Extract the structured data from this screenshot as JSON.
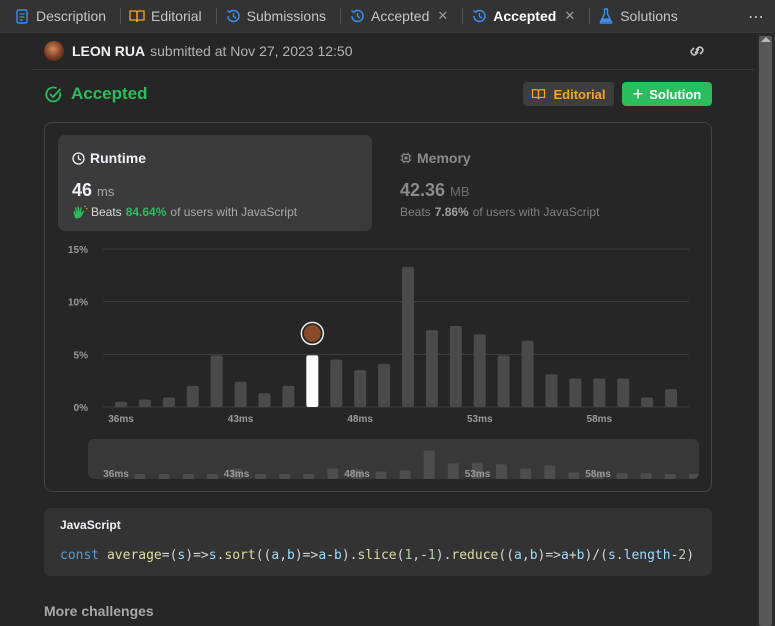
{
  "tabs": [
    {
      "label": "Description",
      "icon": "description-icon",
      "active": false,
      "closable": false
    },
    {
      "label": "Editorial",
      "icon": "book-icon",
      "active": false,
      "closable": false
    },
    {
      "label": "Submissions",
      "icon": "history-icon",
      "active": false,
      "closable": false
    },
    {
      "label": "Accepted",
      "icon": "history-icon",
      "active": false,
      "closable": true
    },
    {
      "label": "Accepted",
      "icon": "history-icon",
      "active": true,
      "closable": true
    },
    {
      "label": "Solutions",
      "icon": "flask-icon",
      "active": false,
      "closable": false
    }
  ],
  "more_label": "⋯",
  "submission": {
    "user": "LEON RUA",
    "text": "submitted at Nov 27, 2023 12:50"
  },
  "status": "Accepted",
  "buttons": {
    "editorial": "Editorial",
    "solution": "Solution"
  },
  "runtime": {
    "title": "Runtime",
    "value": "46",
    "unit": "ms",
    "beats_label": "Beats",
    "beats_pct": "84.64%",
    "beats_suffix": "of users with JavaScript"
  },
  "memory": {
    "title": "Memory",
    "value": "42.36",
    "unit": "MB",
    "beats_label": "Beats",
    "beats_pct": "7.86%",
    "beats_suffix": "of users with JavaScript"
  },
  "chart_data": {
    "type": "bar",
    "ytick_labels": [
      "15%",
      "10%",
      "5%",
      "0%"
    ],
    "yticks": [
      15,
      10,
      5,
      0
    ],
    "ylim": [
      0,
      15
    ],
    "xtick_labels": [
      "36ms",
      "43ms",
      "48ms",
      "53ms",
      "58ms"
    ],
    "xtick_bar_index": [
      0,
      5,
      10,
      15,
      20
    ],
    "values": [
      0.5,
      0.7,
      0.9,
      2.0,
      4.9,
      2.4,
      1.3,
      2.0,
      4.9,
      4.5,
      3.5,
      4.1,
      13.3,
      7.3,
      7.7,
      6.9,
      4.9,
      6.3,
      3.1,
      2.7,
      2.7,
      2.7,
      0.9,
      1.7
    ],
    "highlight_index": 8,
    "grid": true,
    "colors": {
      "bar": "#4a4a4a",
      "highlight": "#ffffff",
      "grid": "#3e3e3e",
      "tick": "#9a9a9a"
    }
  },
  "code": {
    "language": "JavaScript",
    "text": "const average=(s)=>s.sort((a,b)=>a-b).slice(1,-1).reduce((a,b)=>a+b)/(s.length-2)"
  },
  "more_challenges": "More challenges",
  "colors": {
    "accent_green": "#2cbb5d",
    "accent_orange": "#f5a623",
    "tab_blue": "#3b8eea"
  }
}
